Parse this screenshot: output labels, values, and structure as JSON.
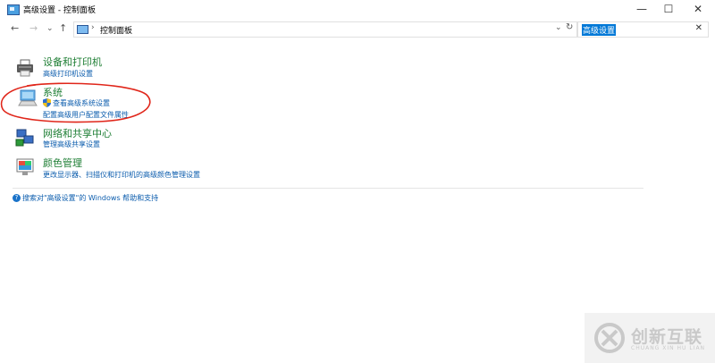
{
  "window": {
    "title": "高级设置 - 控制面板",
    "controls": {
      "minimize": "—",
      "maximize": "☐",
      "close": "✕"
    }
  },
  "address_bar": {
    "back": "←",
    "forward": "→",
    "recent": "⌄",
    "up": "↑",
    "separator": "›",
    "path": "控制面板",
    "dropdown": "⌄",
    "refresh": "↻"
  },
  "search": {
    "value": "高级设置",
    "clear": "✕"
  },
  "results": [
    {
      "title": "设备和打印机",
      "links": [
        "高级打印机设置"
      ]
    },
    {
      "title": "系统",
      "links": [
        "查看高级系统设置",
        "配置高级用户配置文件属性"
      ]
    },
    {
      "title": "网络和共享中心",
      "links": [
        "管理高级共享设置"
      ]
    },
    {
      "title": "颜色管理",
      "links": [
        "更改显示器、扫描仪和打印机的高级颜色管理设置"
      ]
    }
  ],
  "help": {
    "icon": "?",
    "text": "搜索对\"高级设置\"的 Windows 帮助和支持"
  },
  "annotation": {
    "color": "#e0261a"
  },
  "watermark": {
    "name_cn": "创新互联",
    "name_en": "CHUANG XIN HU LIAN"
  },
  "colors": {
    "link": "#0b5cad",
    "title": "#1e7e34",
    "selection": "#0078d7"
  }
}
